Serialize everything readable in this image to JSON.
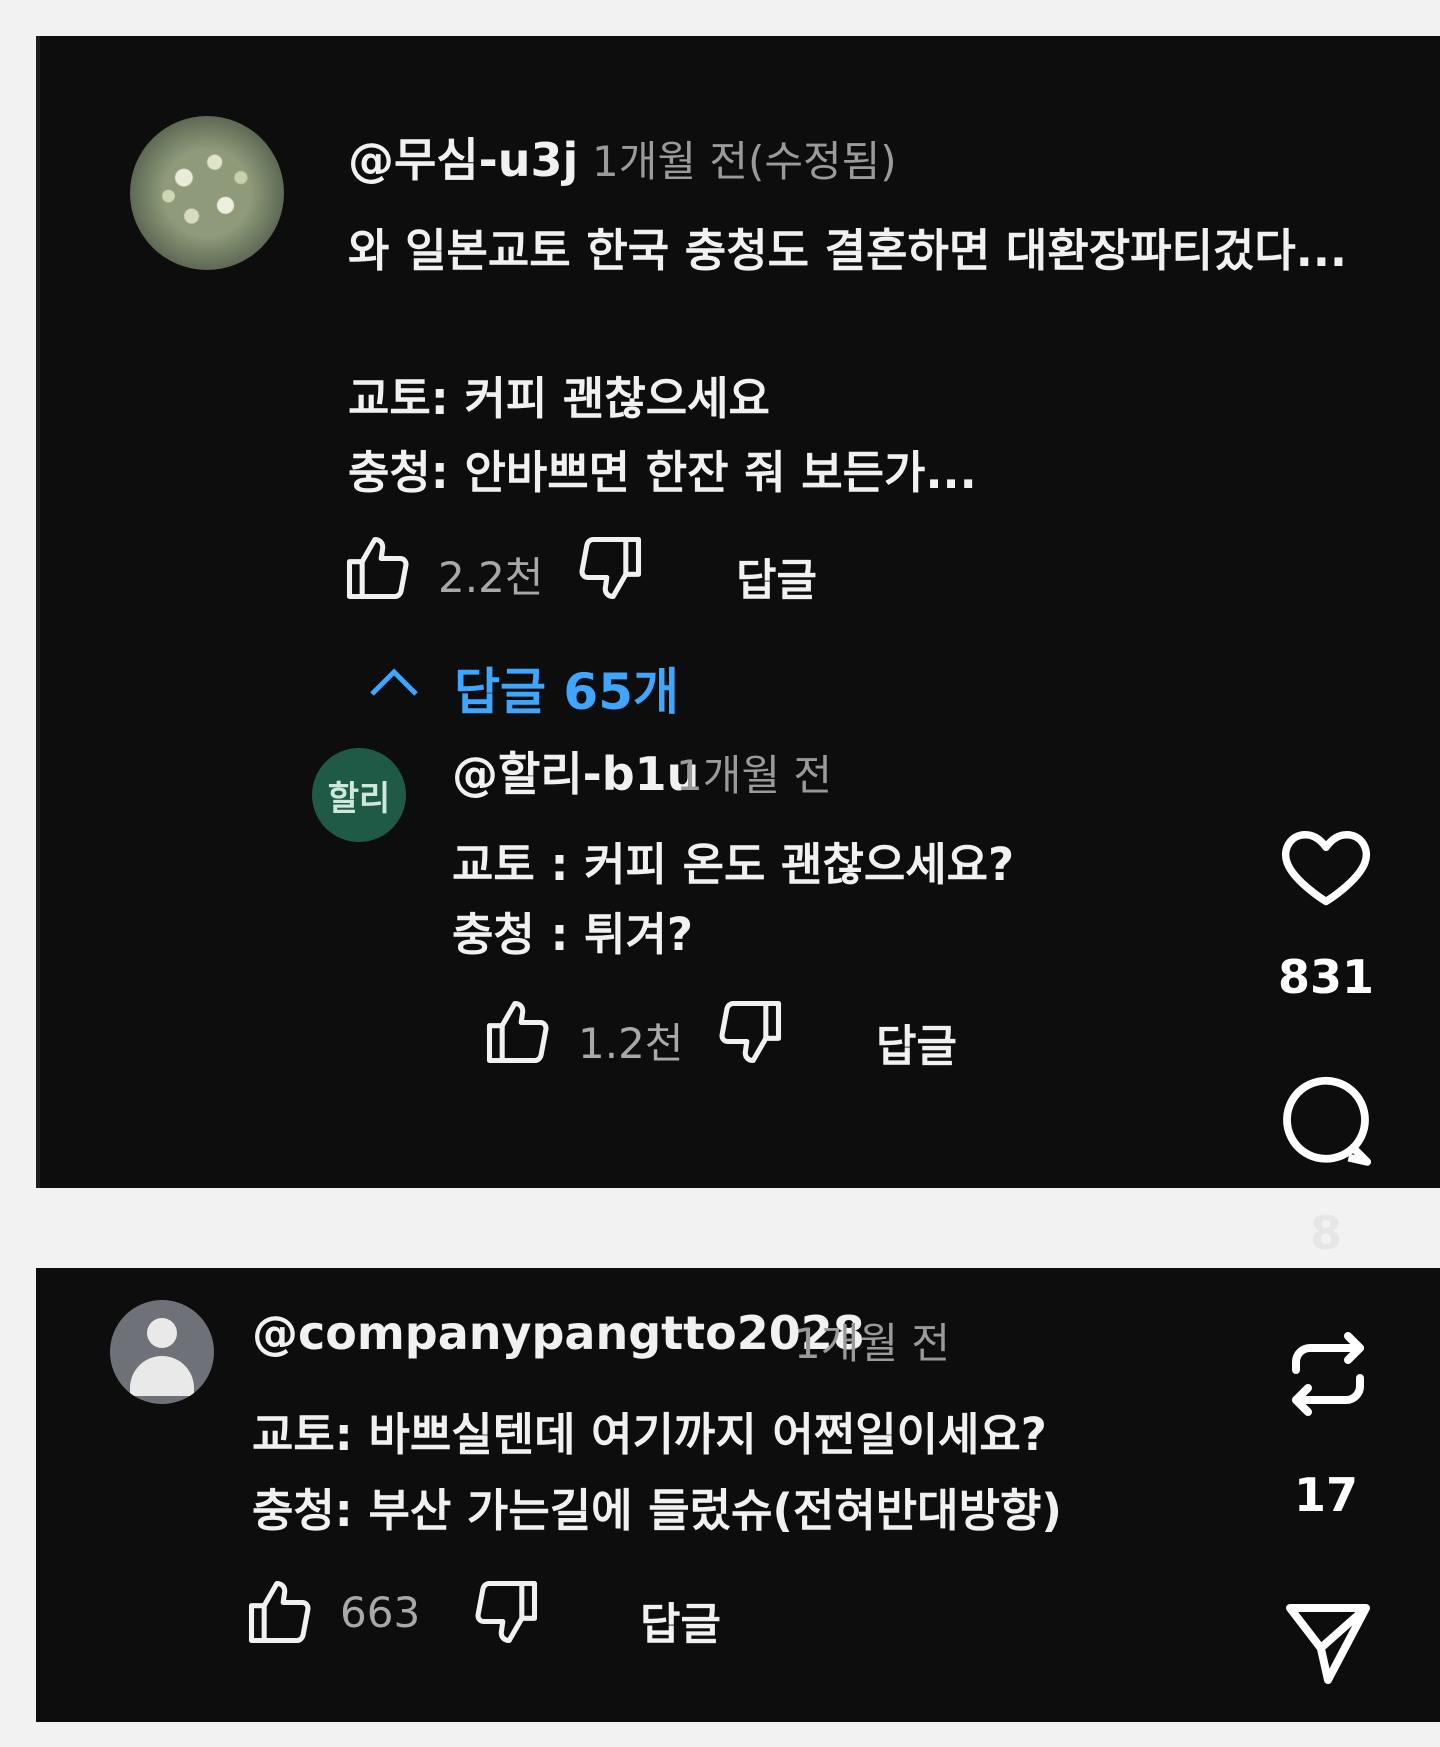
{
  "comments": [
    {
      "handle": "@무심-u3j",
      "time": "1개월 전(수정됨)",
      "lines": [
        "와 일본교토 한국 충청도 결혼하면 대환장파티겄다...",
        "교토: 커피 괜찮으세요",
        "충청: 안바쁘면 한잔 줘 보든가..."
      ],
      "likes": "2.2천",
      "reply_label": "답글",
      "replies_toggle": "답글 65개"
    },
    {
      "handle": "@할리-b1u",
      "avatar_text": "할리",
      "time": "1개월 전",
      "lines": [
        "교토 : 커피 온도 괜찮으세요?",
        "충청 : 튀겨?"
      ],
      "likes": "1.2천",
      "reply_label": "답글"
    },
    {
      "handle": "@companypangtto2028",
      "time": "1개월 전",
      "lines": [
        "교토: 바쁘실텐데 여기까지 어쩐일이세요?",
        "충청: 부산 가는길에 들렀슈(전혀반대방향)"
      ],
      "likes": "663",
      "reply_label": "답글"
    }
  ],
  "side_actions": {
    "like_count": "831",
    "comment_count": "8",
    "repost_count": "17"
  }
}
